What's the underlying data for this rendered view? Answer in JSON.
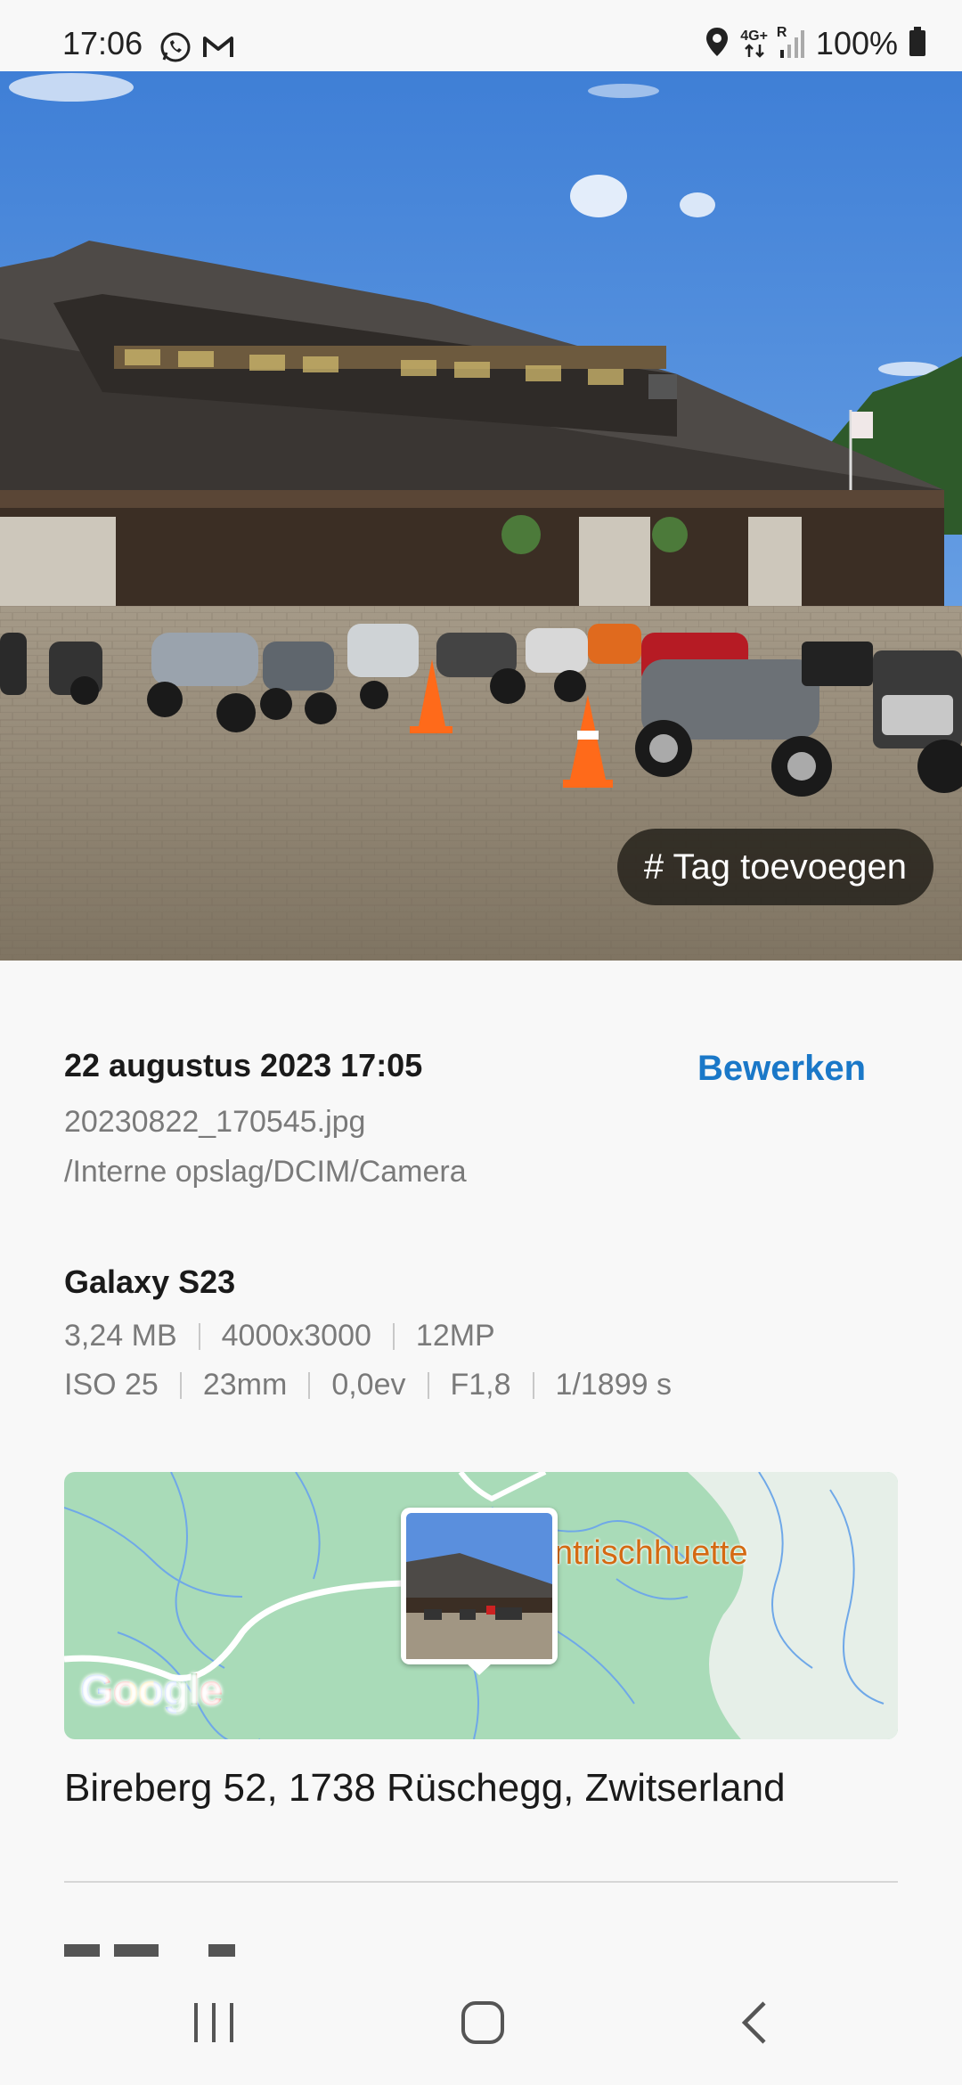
{
  "status_bar": {
    "time": "17:06",
    "left_icons": [
      "whatsapp-icon",
      "gmail-icon"
    ],
    "right_icons": [
      "location-icon",
      "network-4g-icon",
      "signal-icon",
      "battery-icon"
    ],
    "network_label": "4G+",
    "roaming_label": "R",
    "battery_percent": "100%"
  },
  "photo": {
    "tag_button_label": "# Tag toevoegen"
  },
  "details": {
    "date": "22 augustus 2023 17:05",
    "edit_label": "Bewerken",
    "filename": "20230822_170545.jpg",
    "path": "/Interne opslag/DCIM/Camera",
    "device": "Galaxy S23",
    "specs_row1": [
      "3,24 MB",
      "4000x3000",
      "12MP"
    ],
    "specs_row2": [
      "ISO 25",
      "23mm",
      "0,0ev",
      "F1,8",
      "1/1899 s"
    ]
  },
  "map": {
    "place_label": "ntrischhuette",
    "provider_logo": "Google",
    "colors": {
      "land": "#a9dbb8",
      "water": "#6fa8e8",
      "road": "#ffffff",
      "label": "#d46a12"
    }
  },
  "location": {
    "address": "Bireberg 52, 1738 Rüschegg, Zwitserland"
  },
  "nav_bar": {
    "buttons": [
      "recents-icon",
      "home-icon",
      "back-icon"
    ]
  },
  "colors": {
    "accent": "#1a78c8",
    "background": "#f8f8f8",
    "secondary_text": "#7a7a7a"
  }
}
